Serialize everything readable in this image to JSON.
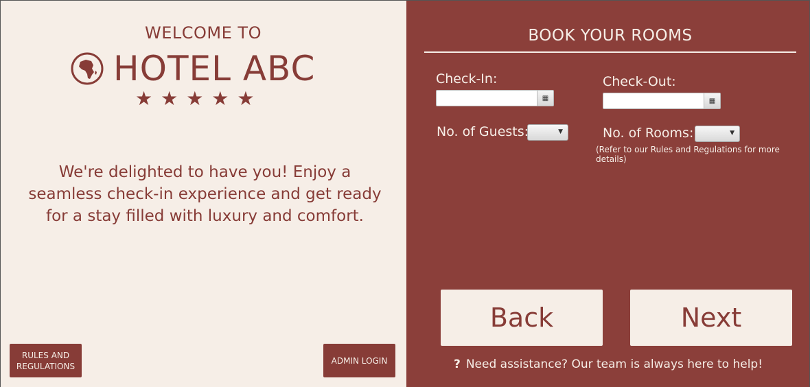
{
  "left": {
    "welcome": "WELCOME TO",
    "hotel_name": "HOTEL ABC",
    "stars": "★★★★★",
    "tagline": "We're delighted to have you! Enjoy a seamless check-in experience and get ready for a stay filled with luxury and comfort.",
    "rules_button": "RULES AND REGULATIONS",
    "admin_button": "ADMIN LOGIN"
  },
  "booking": {
    "title": "BOOK YOUR ROOMS",
    "check_in_label": "Check-In:",
    "check_in_value": "",
    "check_out_label": "Check-Out:",
    "check_out_value": "",
    "guests_label": "No. of Guests:",
    "guests_value": "",
    "rooms_label": "No. of Rooms:",
    "rooms_value": "",
    "rooms_note": "(Refer to our Rules and Regulations for more details)",
    "back_button": "Back",
    "next_button": "Next",
    "help_icon": "?",
    "help_text": "Need assistance? Our team is always here to help!"
  },
  "colors": {
    "accent": "#873c37",
    "panel_bg": "#8b3f3a",
    "cream": "#f6eee7"
  },
  "icons": [
    "globe-africa-icon",
    "star-icon",
    "calendar-icon",
    "dropdown-arrow-icon",
    "question-icon"
  ]
}
